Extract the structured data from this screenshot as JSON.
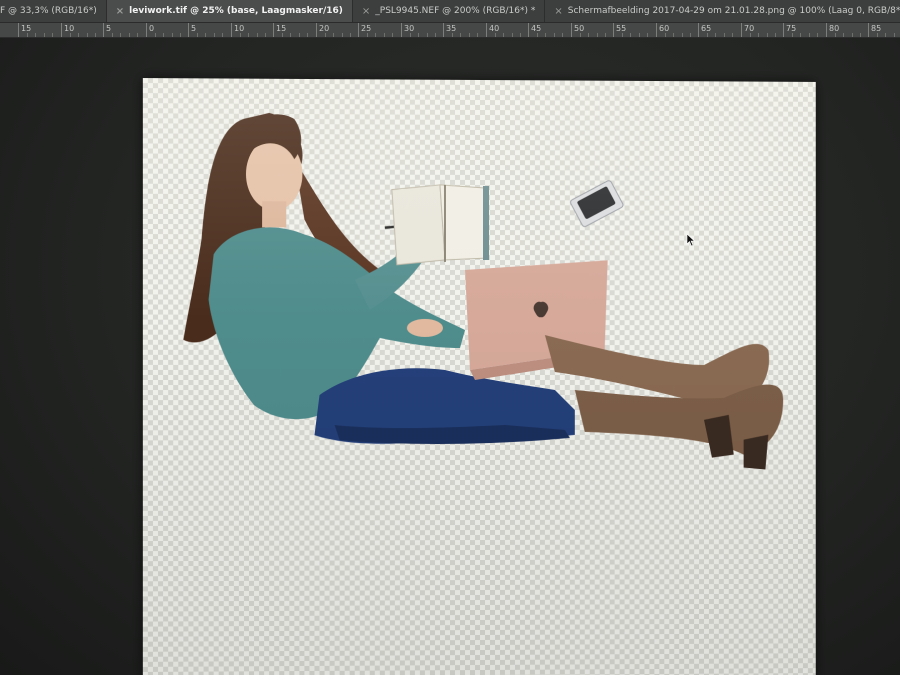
{
  "tabs": [
    {
      "label": "F @ 33,3% (RGB/16*)",
      "active": false,
      "has_close": false
    },
    {
      "label": "leviwork.tif @ 25% (base, Laagmasker/16)",
      "active": true,
      "has_close": true
    },
    {
      "label": "_PSL9945.NEF @ 200% (RGB/16*) *",
      "active": false,
      "has_close": true
    },
    {
      "label": "Schermafbeelding 2017-04-29 om 21.01.28.png @ 100% (Laag 0, RGB/8*)",
      "active": false,
      "has_close": true
    }
  ],
  "close_glyph": "×",
  "ruler": {
    "labels": [
      "15",
      "10",
      "5",
      "0",
      "5",
      "10",
      "15",
      "20",
      "25",
      "30",
      "35",
      "40",
      "45",
      "50",
      "55",
      "60",
      "65",
      "70",
      "75",
      "80",
      "85"
    ]
  },
  "icons": {
    "tab_close": "close-icon",
    "cursor": "arrow-cursor-icon",
    "laptop_logo": "apple-logo-icon"
  },
  "colors": {
    "canvas_bg": "#f3f3ee",
    "checker": "#d9d9d3",
    "sweater": "#4f8c8c",
    "jeans": "#24407a",
    "boots": "#8a6a52",
    "laptop": "#d6a99a",
    "hair": "#4a2c1c"
  }
}
